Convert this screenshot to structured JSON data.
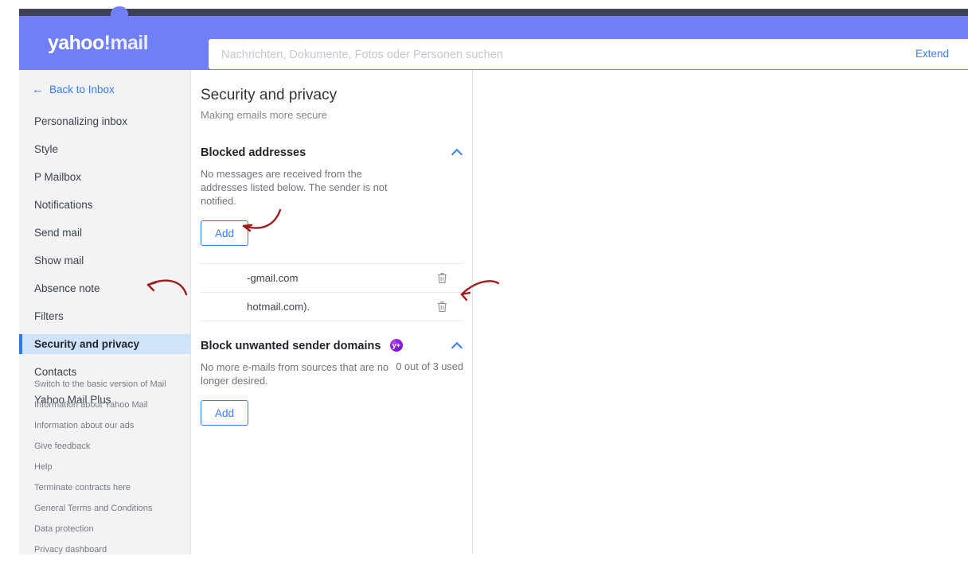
{
  "header": {
    "brand_yahoo": "yahoo",
    "brand_excl": "!",
    "brand_mail": "mail",
    "search_placeholder": "Nachrichten, Dokumente, Fotos oder Personen suchen",
    "search_value": "",
    "extend_label": "Extend",
    "bg_color": "#717ff6"
  },
  "sidebar": {
    "back_label": "Back to Inbox",
    "back_icon": "arrow-left-icon",
    "items": [
      {
        "label": "Personalizing inbox",
        "active": false
      },
      {
        "label": "Style",
        "active": false
      },
      {
        "label": "P Mailbox",
        "active": false
      },
      {
        "label": "Notifications",
        "active": false
      },
      {
        "label": "Send mail",
        "active": false
      },
      {
        "label": "Show mail",
        "active": false
      },
      {
        "label": "Absence note",
        "active": false
      },
      {
        "label": "Filters",
        "active": false
      },
      {
        "label": "Security and privacy",
        "active": true
      },
      {
        "label": "Contacts",
        "active": false
      },
      {
        "label": "Yahoo Mail Plus",
        "active": false
      }
    ],
    "footer_links": [
      "Switch to the basic version of Mail",
      "Information about Yahoo Mail",
      "Information about our ads",
      "Give feedback",
      "Help",
      "Terminate contracts here",
      "General Terms and Conditions",
      "Data protection",
      "Privacy dashboard"
    ],
    "active_bg_color": "#cfe4fb",
    "active_border_color": "#2f7ae5"
  },
  "panel": {
    "title": "Security and privacy",
    "subtitle": "Making emails more secure",
    "blocked_section": {
      "title": "Blocked addresses",
      "collapse_icon": "chevron-up-icon",
      "description": "No messages are received from the addresses listed below. The sender is not notified.",
      "add_label": "Add",
      "addresses": [
        {
          "text": "-gmail.com",
          "delete_icon": "trash-icon"
        },
        {
          "text": "hotmail.com).",
          "delete_icon": "trash-icon"
        }
      ]
    },
    "domains_section": {
      "title": "Block unwanted sender domains",
      "badge_label": "y+",
      "badge_color": "#8a1fd6",
      "collapse_icon": "chevron-up-icon",
      "description": "No more e-mails from sources that are no longer desired.",
      "usage": "0 out of 3 used",
      "add_label": "Add"
    }
  },
  "annotations": {
    "color": "#9e1b1b",
    "arrows": [
      {
        "name": "arrow-pointing-to-security-and-privacy"
      },
      {
        "name": "arrow-pointing-to-add-button"
      },
      {
        "name": "arrow-pointing-to-delete-icon"
      }
    ]
  }
}
